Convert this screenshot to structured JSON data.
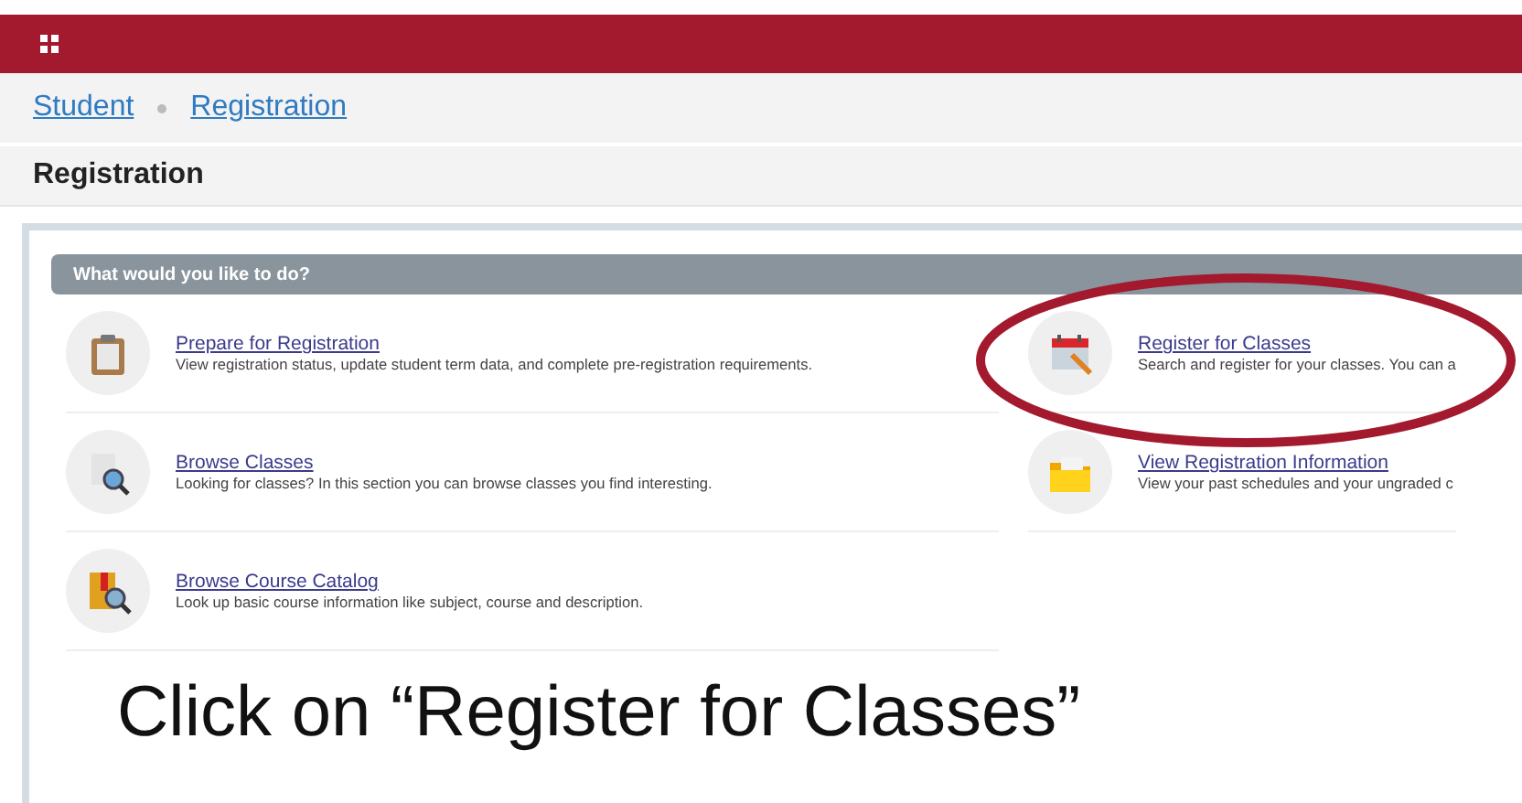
{
  "breadcrumb": [
    {
      "label": "Student"
    },
    {
      "label": "Registration"
    }
  ],
  "page_title": "Registration",
  "panel": {
    "heading": "What would you like to do?",
    "columns": [
      [
        {
          "kind": "clipboard",
          "title": "Prepare for Registration",
          "description": "View registration status, update student term data, and complete pre-registration requirements."
        },
        {
          "kind": "magnifier",
          "title": "Browse Classes",
          "description": "Looking for classes? In this section you can browse classes you find interesting."
        },
        {
          "kind": "catalog",
          "title": "Browse Course Catalog",
          "description": "Look up basic course information like subject, course and description."
        }
      ],
      [
        {
          "kind": "calendar",
          "title": "Register for Classes",
          "description": "Search and register for your classes. You can a"
        },
        {
          "kind": "folder",
          "title": "View Registration Information",
          "description": "View your past schedules and your ungraded c"
        }
      ]
    ]
  },
  "annotation": {
    "caption": "Click on “Register for Classes”"
  }
}
